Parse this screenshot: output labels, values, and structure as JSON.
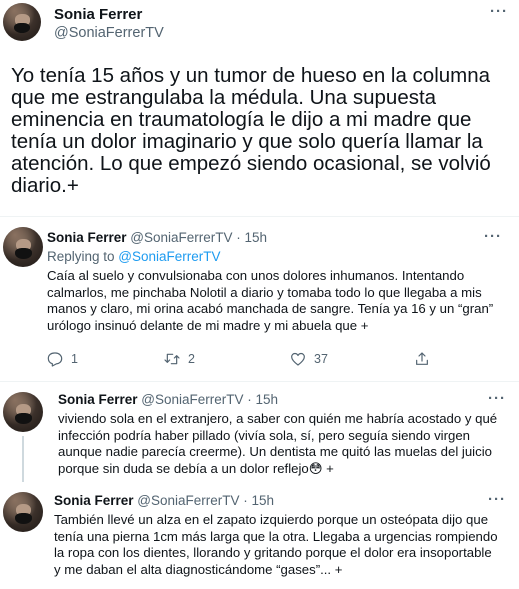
{
  "main": {
    "name": "Sonia Ferrer",
    "handle": "@SoniaFerrerTV",
    "more": "···",
    "lines": [
      "Yo tenía 15 años y un tumor de hueso en la columna",
      "que me estrangulaba la médula. Una supuesta",
      "eminencia en traumatología le dijo a mi madre que",
      "tenía un dolor imaginario y que solo quería llamar la",
      "atención. Lo que empezó siendo ocasional, se volvió",
      "diario.+"
    ]
  },
  "replies": [
    {
      "name": "Sonia Ferrer",
      "handle": "@SoniaFerrerTV · 15h",
      "more": "···",
      "replying_prefix": "Replying to ",
      "replying_to": "@SoniaFerrerTV",
      "lines": [
        "Caía al suelo y convulsionaba con unos dolores inhumanos. Intentando",
        "calmarlos, me pinchaba Nolotil a diario y tomaba todo lo que llegaba a mis",
        "manos y claro, mi orina acabó manchada de sangre. Tenía ya 16 y un “gran”",
        "urólogo insinuó delante de mi madre y mi abuela que +"
      ],
      "actions": {
        "reply_count": "1",
        "retweet_count": "2",
        "like_count": "37"
      }
    },
    {
      "name": "Sonia Ferrer",
      "handle": "@SoniaFerrerTV · 15h",
      "more": "···",
      "lines": [
        "viviendo sola en el extranjero, a saber con quién me habría acostado y qué",
        "infección podría haber pillado (vivía sola, sí, pero seguía siendo virgen",
        "aunque nadie parecía creerme). Un dentista me quitó las muelas del juicio",
        "porque sin duda se debía a un dolor reflejo😳 +"
      ]
    },
    {
      "name": "Sonia Ferrer",
      "handle": "@SoniaFerrerTV · 15h",
      "more": "···",
      "lines": [
        "También llevé un alza en el zapato izquierdo porque un osteópata dijo que",
        "tenía una pierna 1cm más larga que la otra. Llegaba a urgencias rompiendo",
        "la ropa con los dientes, llorando y gritando porque el dolor era insoportable",
        "y me daban el alta diagnosticándome “gases”... +"
      ]
    }
  ],
  "colors": {
    "text": "#0f1419",
    "secondary": "#536471",
    "link": "#1d9bf0",
    "divider": "#eff3f4",
    "thread": "#cfd9de"
  },
  "icons": [
    "reply-icon",
    "retweet-icon",
    "like-icon",
    "share-icon",
    "more-icon"
  ]
}
